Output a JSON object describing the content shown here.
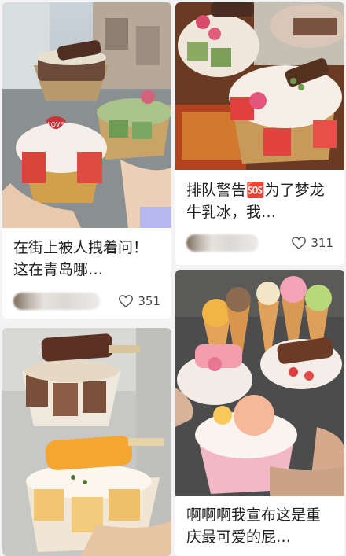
{
  "cards": [
    {
      "title": "在街上被人拽着问！这在青岛哪…",
      "likes": "351",
      "image": "two-hands-holding-ice-cream-bowls-on-street"
    },
    {
      "title": "排队警告🆘为了梦龙牛乳冰，我…",
      "likes": "311",
      "image": "ice-cream-bowls-with-fruit-on-table"
    },
    {
      "title": "",
      "likes": "",
      "image": "hand-holding-chocolate-and-mango-ice-cream-bowls"
    },
    {
      "title": "啊啊啊我宣布这是重庆最可爱的屁…",
      "likes": "",
      "image": "cute-animal-ice-cream-cones-and-bowls"
    }
  ],
  "icons": {
    "heart": "heart-outline-icon"
  },
  "colors": {
    "background": "#f3f3f3",
    "card": "#ffffff",
    "text": "#1f1f1f"
  }
}
